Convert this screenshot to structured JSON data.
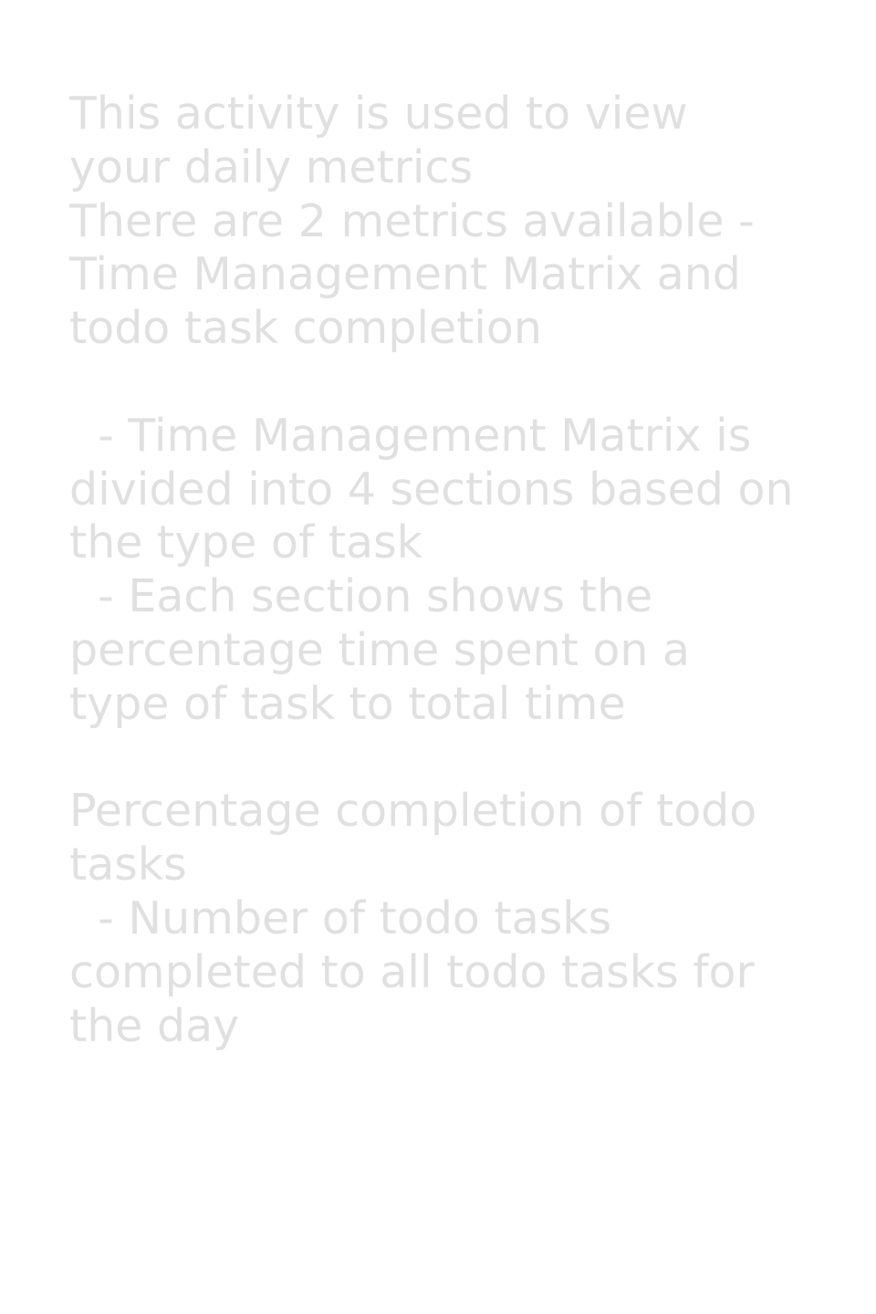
{
  "help": {
    "text": "This activity is used to view your daily metrics\nThere are 2 metrics available - Time Management Matrix and todo task completion\n\n  - Time Management Matrix is divided into 4 sections based on the type of task\n  - Each section shows the percentage time spent on a type of task to total time\n\nPercentage completion of todo tasks\n  - Number of todo tasks completed to all todo tasks for the day"
  },
  "colors": {
    "background": "#ffffff",
    "text": "#e0e0e0"
  }
}
